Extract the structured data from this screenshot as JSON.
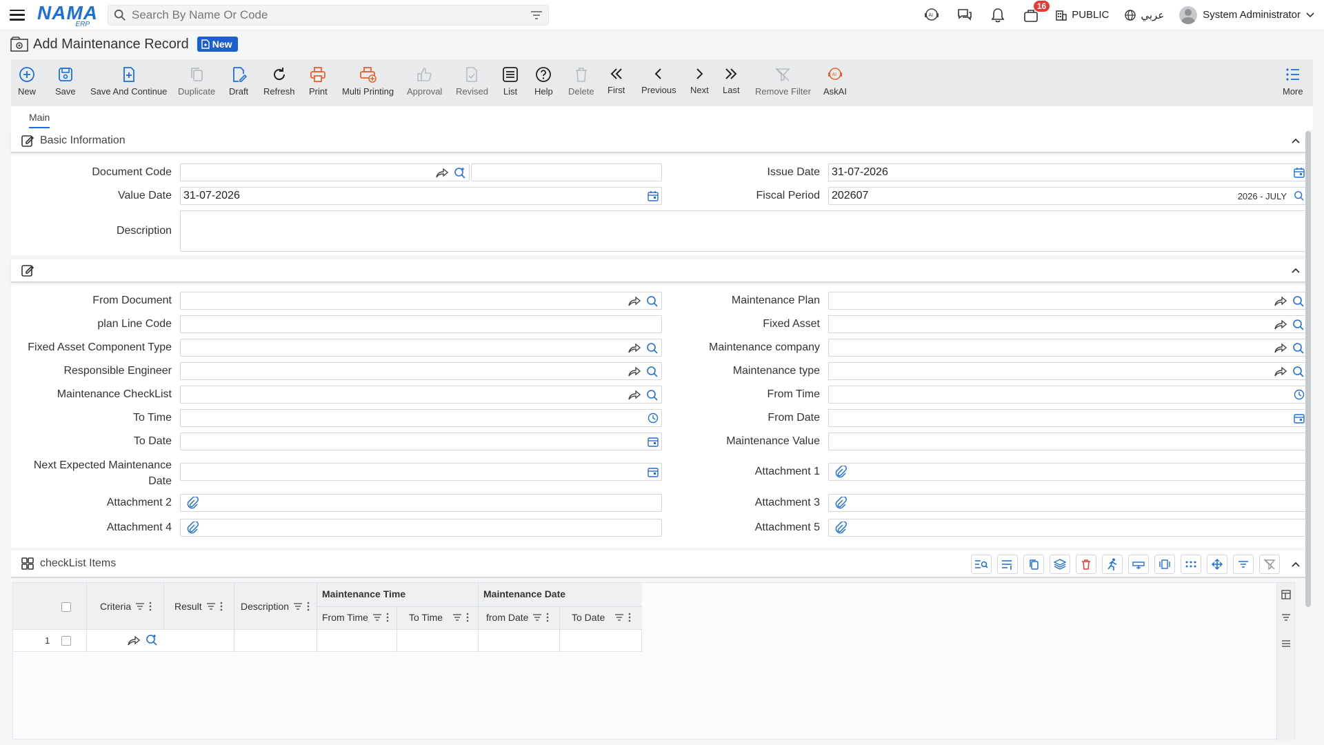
{
  "header": {
    "logo_text": "NAMA",
    "logo_sub": "ERP",
    "search_placeholder": "Search By Name Or Code",
    "notification_count": "16",
    "branch": "PUBLIC",
    "language": "عربي",
    "user_name": "System Administrator"
  },
  "page": {
    "title": "Add Maintenance Record",
    "status_badge": "New"
  },
  "toolbar": {
    "new": "New",
    "save": "Save",
    "save_continue": "Save And Continue",
    "duplicate": "Duplicate",
    "draft": "Draft",
    "refresh": "Refresh",
    "print": "Print",
    "multi_printing": "Multi Printing",
    "approval": "Approval",
    "revised": "Revised",
    "list": "List",
    "help": "Help",
    "delete": "Delete",
    "first": "First",
    "previous": "Previous",
    "next": "Next",
    "last": "Last",
    "remove_filter": "Remove Filter",
    "askai": "AskAI",
    "more": "More"
  },
  "tabs": {
    "main": "Main"
  },
  "basic": {
    "section_title": "Basic Information",
    "document_code_label": "Document Code",
    "issue_date_label": "Issue Date",
    "issue_date_value": "31-07-2026",
    "value_date_label": "Value Date",
    "value_date_value": "31-07-2026",
    "fiscal_period_label": "Fiscal Period",
    "fiscal_period_value": "202607",
    "fiscal_period_desc": "2026 - JULY",
    "description_label": "Description"
  },
  "details": {
    "from_document": "From Document",
    "maintenance_plan": "Maintenance Plan",
    "plan_line_code": "plan Line Code",
    "fixed_asset": "Fixed Asset",
    "fixed_asset_component_type": "Fixed Asset Component Type",
    "maintenance_company": "Maintenance company",
    "responsible_engineer": "Responsible Engineer",
    "maintenance_type": "Maintenance type",
    "maintenance_checklist": "Maintenance CheckList",
    "from_time": "From Time",
    "to_time": "To Time",
    "from_date": "From Date",
    "to_date": "To Date",
    "maintenance_value": "Maintenance Value",
    "next_expected_1": "Next Expected Maintenance",
    "next_expected_2": "Date",
    "attachment_1": "Attachment 1",
    "attachment_2": "Attachment 2",
    "attachment_3": "Attachment 3",
    "attachment_4": "Attachment 4",
    "attachment_5": "Attachment 5"
  },
  "grid": {
    "title": "checkList Items",
    "col_criteria": "Criteria",
    "col_result": "Result",
    "col_description": "Description",
    "group_time": "Maintenance Time",
    "group_date": "Maintenance Date",
    "col_from_time": "From Time",
    "col_to_time": "To Time",
    "col_from_date": "from Date",
    "col_to_date": "To Date",
    "row_1_number": "1"
  },
  "colors": {
    "accent": "#1e6fd9",
    "print": "#e8612c",
    "danger": "#e53935"
  }
}
